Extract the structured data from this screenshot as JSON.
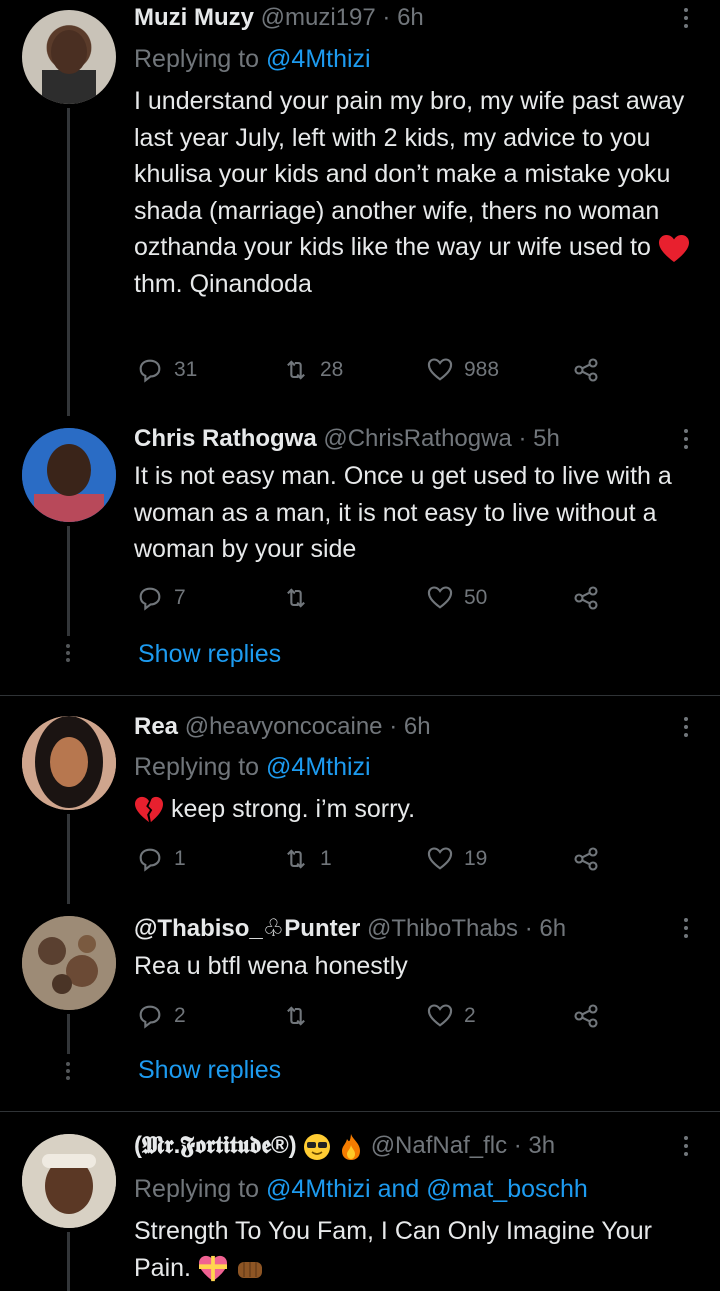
{
  "tweets": [
    {
      "name": "Muzi Muzy",
      "handle": "@muzi197",
      "time": "· 6h",
      "replying_prefix": "Replying to",
      "replying_to": "@4Mthizi",
      "text_before_emoji": "I understand your pain my bro, my wife past away last year July, left with 2 kids, my advice to you khulisa your kids and don’t make a mistake yoku shada (marriage) another wife, thers no woman ozthanda your kids like the way ur wife used to",
      "text_after_emoji": "thm. Qinandoda",
      "replies": "31",
      "retweets": "28",
      "likes": "988"
    },
    {
      "name": "Chris Rathogwa",
      "handle": "@ChrisRathogwa",
      "time": "· 5h",
      "text": "It is not easy man. Once u get used to live with a woman as a man, it is not easy to live without a woman by your side",
      "replies": "7",
      "retweets": "",
      "likes": "50",
      "show_replies": "Show replies"
    },
    {
      "name": "Rea",
      "handle": "@heavyoncocaine",
      "time": "· 6h",
      "replying_prefix": "Replying to",
      "replying_to": "@4Mthizi",
      "text": "keep strong. i’m sorry.",
      "replies": "1",
      "retweets": "1",
      "likes": "19"
    },
    {
      "name": "@Thabiso_♧Punter",
      "handle": "@ThiboThabs",
      "time": "· 6h",
      "text": "Rea u btfl wena honestly",
      "replies": "2",
      "retweets": "",
      "likes": "2",
      "show_replies": "Show replies"
    },
    {
      "name": "(𝕸𝖗.𝕱𝖔𝖗𝖙𝖎𝖙𝖚𝖉𝖊®)",
      "handle": "@NafNaf_flc",
      "time": "· 3h",
      "replying_prefix": "Replying to",
      "replying_to": "@4Mthizi",
      "replying_and": "and",
      "replying_to_2": "@mat_boschh",
      "text": "Strength To You Fam, I Can Only Imagine Your Pain."
    }
  ],
  "colors": {
    "background": "#000000",
    "text": "#e7e9ea",
    "muted": "#71767b",
    "link": "#1d9bf0",
    "heart": "#f91880"
  }
}
